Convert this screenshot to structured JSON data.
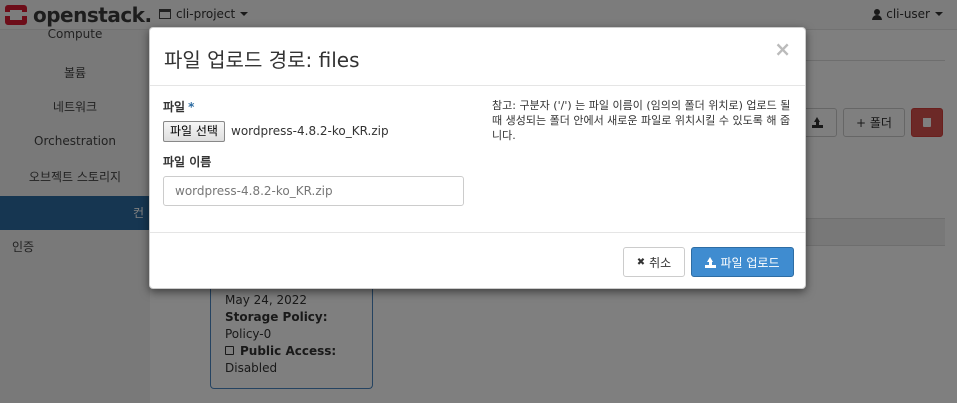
{
  "navbar": {
    "brand": "openstack.",
    "project": "cli-project",
    "user": "cli-user"
  },
  "sidebar": {
    "items": [
      {
        "label": "Compute"
      },
      {
        "label": "볼륨"
      },
      {
        "label": "네트워크"
      },
      {
        "label": "Orchestration"
      },
      {
        "label": "오브젝트 스토리지"
      },
      {
        "label": "컨"
      },
      {
        "label": "인증"
      }
    ]
  },
  "toolbar": {
    "folder_label": "+ 폴더"
  },
  "card": {
    "date": "May 24, 2022",
    "storage_policy_label": "Storage Policy:",
    "storage_policy_value": "Policy-0",
    "public_access_label": "Public Access:",
    "public_access_value": "Disabled"
  },
  "modal": {
    "title": "파일 업로드 경로: files",
    "close": "×",
    "file_label": "파일",
    "required_mark": "*",
    "file_button": "파일 선택",
    "file_name": "wordpress-4.8.2-ko_KR.zip",
    "name_label": "파일 이름",
    "name_placeholder": "wordpress-4.8.2-ko_KR.zip",
    "help_text": "참고: 구분자 ('/') 는 파일 이름이 (임의의 폴더 위치로) 업로드 될 때 생성되는 폴더 안에서 새로운 파일로 위치시킬 수 있도록 해 줍니다.",
    "cancel_label": "취소",
    "upload_label": "파일 업로드"
  },
  "colors": {
    "brand_red": "#da1a32",
    "primary_blue": "#3f8cd0",
    "sidebar_active": "#2d6ca2",
    "danger": "#d9534f"
  }
}
